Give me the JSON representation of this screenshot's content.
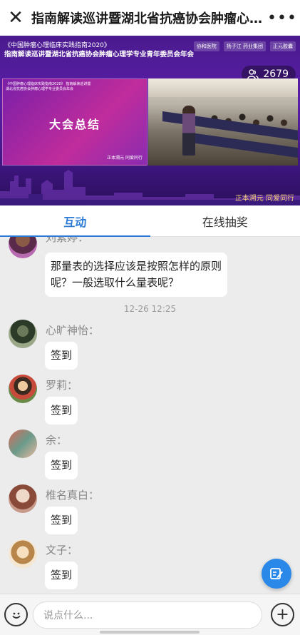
{
  "header": {
    "title": "指南解读巡讲暨湖北省抗癌协会肿瘤心理专业委员会青年委员会年会",
    "close_icon": "close-icon",
    "more_icon": "more-icon"
  },
  "video": {
    "banner_line1": "《中国肿瘤心理临床实践指南2020》",
    "banner_line2": "指南解读巡讲暨湖北省抗癌协会肿瘤心理学专业青年委员会年会",
    "logos": [
      "协和医院",
      "扬子江 药业集团",
      "正元胶囊"
    ],
    "viewer_count": "2679",
    "slide_small_text": "《中国肿瘤心理临床实践指南2020》 指南解读巡讲暨湖北省抗癌协会肿瘤心理学专业委员会年会",
    "slide_title": "大会总结",
    "slide_signature": "正本溯元 同爱同行",
    "footer_signature": "正本溯元 同爱同行"
  },
  "tabs": [
    {
      "label": "互动",
      "active": true
    },
    {
      "label": "在线抽奖",
      "active": false
    }
  ],
  "chat": {
    "messages": [
      {
        "user": "刘素婷：",
        "text_lines": [
          "那量表的选择应该是按照怎样的原则",
          "呢？一般选取什么量表呢？"
        ]
      },
      {
        "user": "心旷神怡：",
        "text": "签到"
      },
      {
        "user": "罗莉：",
        "text": "签到"
      },
      {
        "user": "余：",
        "text": "签到"
      },
      {
        "user": "椎名真白：",
        "text": "签到"
      },
      {
        "user": "文子：",
        "text": "签到"
      }
    ],
    "timestamp": "12-26 12:25"
  },
  "input": {
    "placeholder": "说点什么..."
  },
  "colors": {
    "accent": "#2a7ad6",
    "fab": "#2a88e8",
    "video_bg": "#4a1a8e"
  }
}
